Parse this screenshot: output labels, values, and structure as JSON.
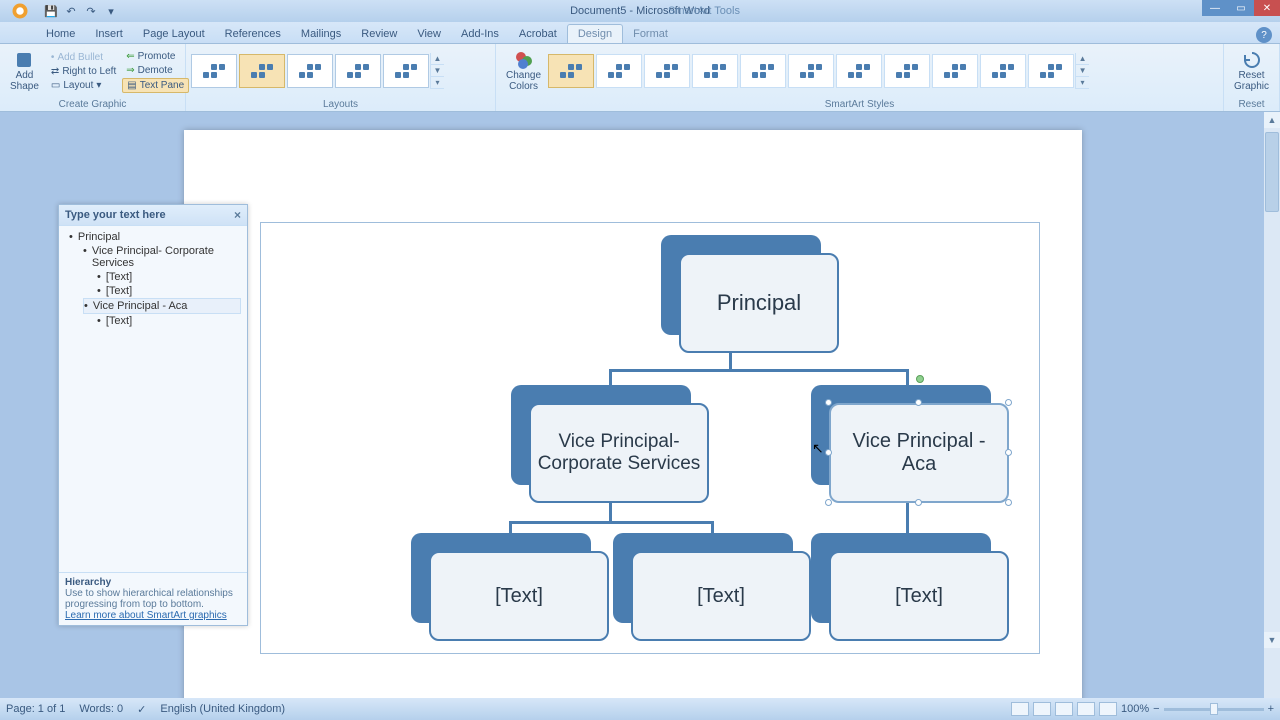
{
  "titlebar": {
    "doc_title": "Document5 - Microsoft Word",
    "tools_title": "SmartArt Tools"
  },
  "tabs": {
    "home": "Home",
    "insert": "Insert",
    "page_layout": "Page Layout",
    "references": "References",
    "mailings": "Mailings",
    "review": "Review",
    "view": "View",
    "addins": "Add-Ins",
    "acrobat": "Acrobat",
    "design": "Design",
    "format": "Format"
  },
  "ribbon": {
    "create_graphic": {
      "add_shape": "Add\nShape",
      "add_bullet": "Add Bullet",
      "right_to_left": "Right to Left",
      "layout": "Layout",
      "promote": "Promote",
      "demote": "Demote",
      "text_pane": "Text Pane",
      "group_label": "Create Graphic"
    },
    "layouts": {
      "group_label": "Layouts"
    },
    "change_colors": "Change\nColors",
    "styles": {
      "group_label": "SmartArt Styles"
    },
    "reset": {
      "btn": "Reset\nGraphic",
      "group_label": "Reset"
    }
  },
  "textpane": {
    "header": "Type your text here",
    "items": [
      {
        "level": 0,
        "text": "Principal"
      },
      {
        "level": 1,
        "text": "Vice Principal- Corporate Services"
      },
      {
        "level": 2,
        "text": "[Text]"
      },
      {
        "level": 2,
        "text": "[Text]"
      },
      {
        "level": 1,
        "text": "Vice Principal -  Aca",
        "selected": true
      },
      {
        "level": 2,
        "text": "[Text]"
      }
    ],
    "hint_title": "Hierarchy",
    "hint_body": "Use to show hierarchical relationships progressing from top to bottom.",
    "hint_link": "Learn more about SmartArt graphics"
  },
  "chart": {
    "nodes": {
      "principal": "Principal",
      "vp_corp": "Vice Principal- Corporate Services",
      "vp_aca": "Vice Principal -  Aca",
      "leaf1": "[Text]",
      "leaf2": "[Text]",
      "leaf3": "[Text]"
    }
  },
  "status": {
    "page": "Page: 1 of 1",
    "words": "Words: 0",
    "lang": "English (United Kingdom)",
    "zoom": "100%"
  }
}
